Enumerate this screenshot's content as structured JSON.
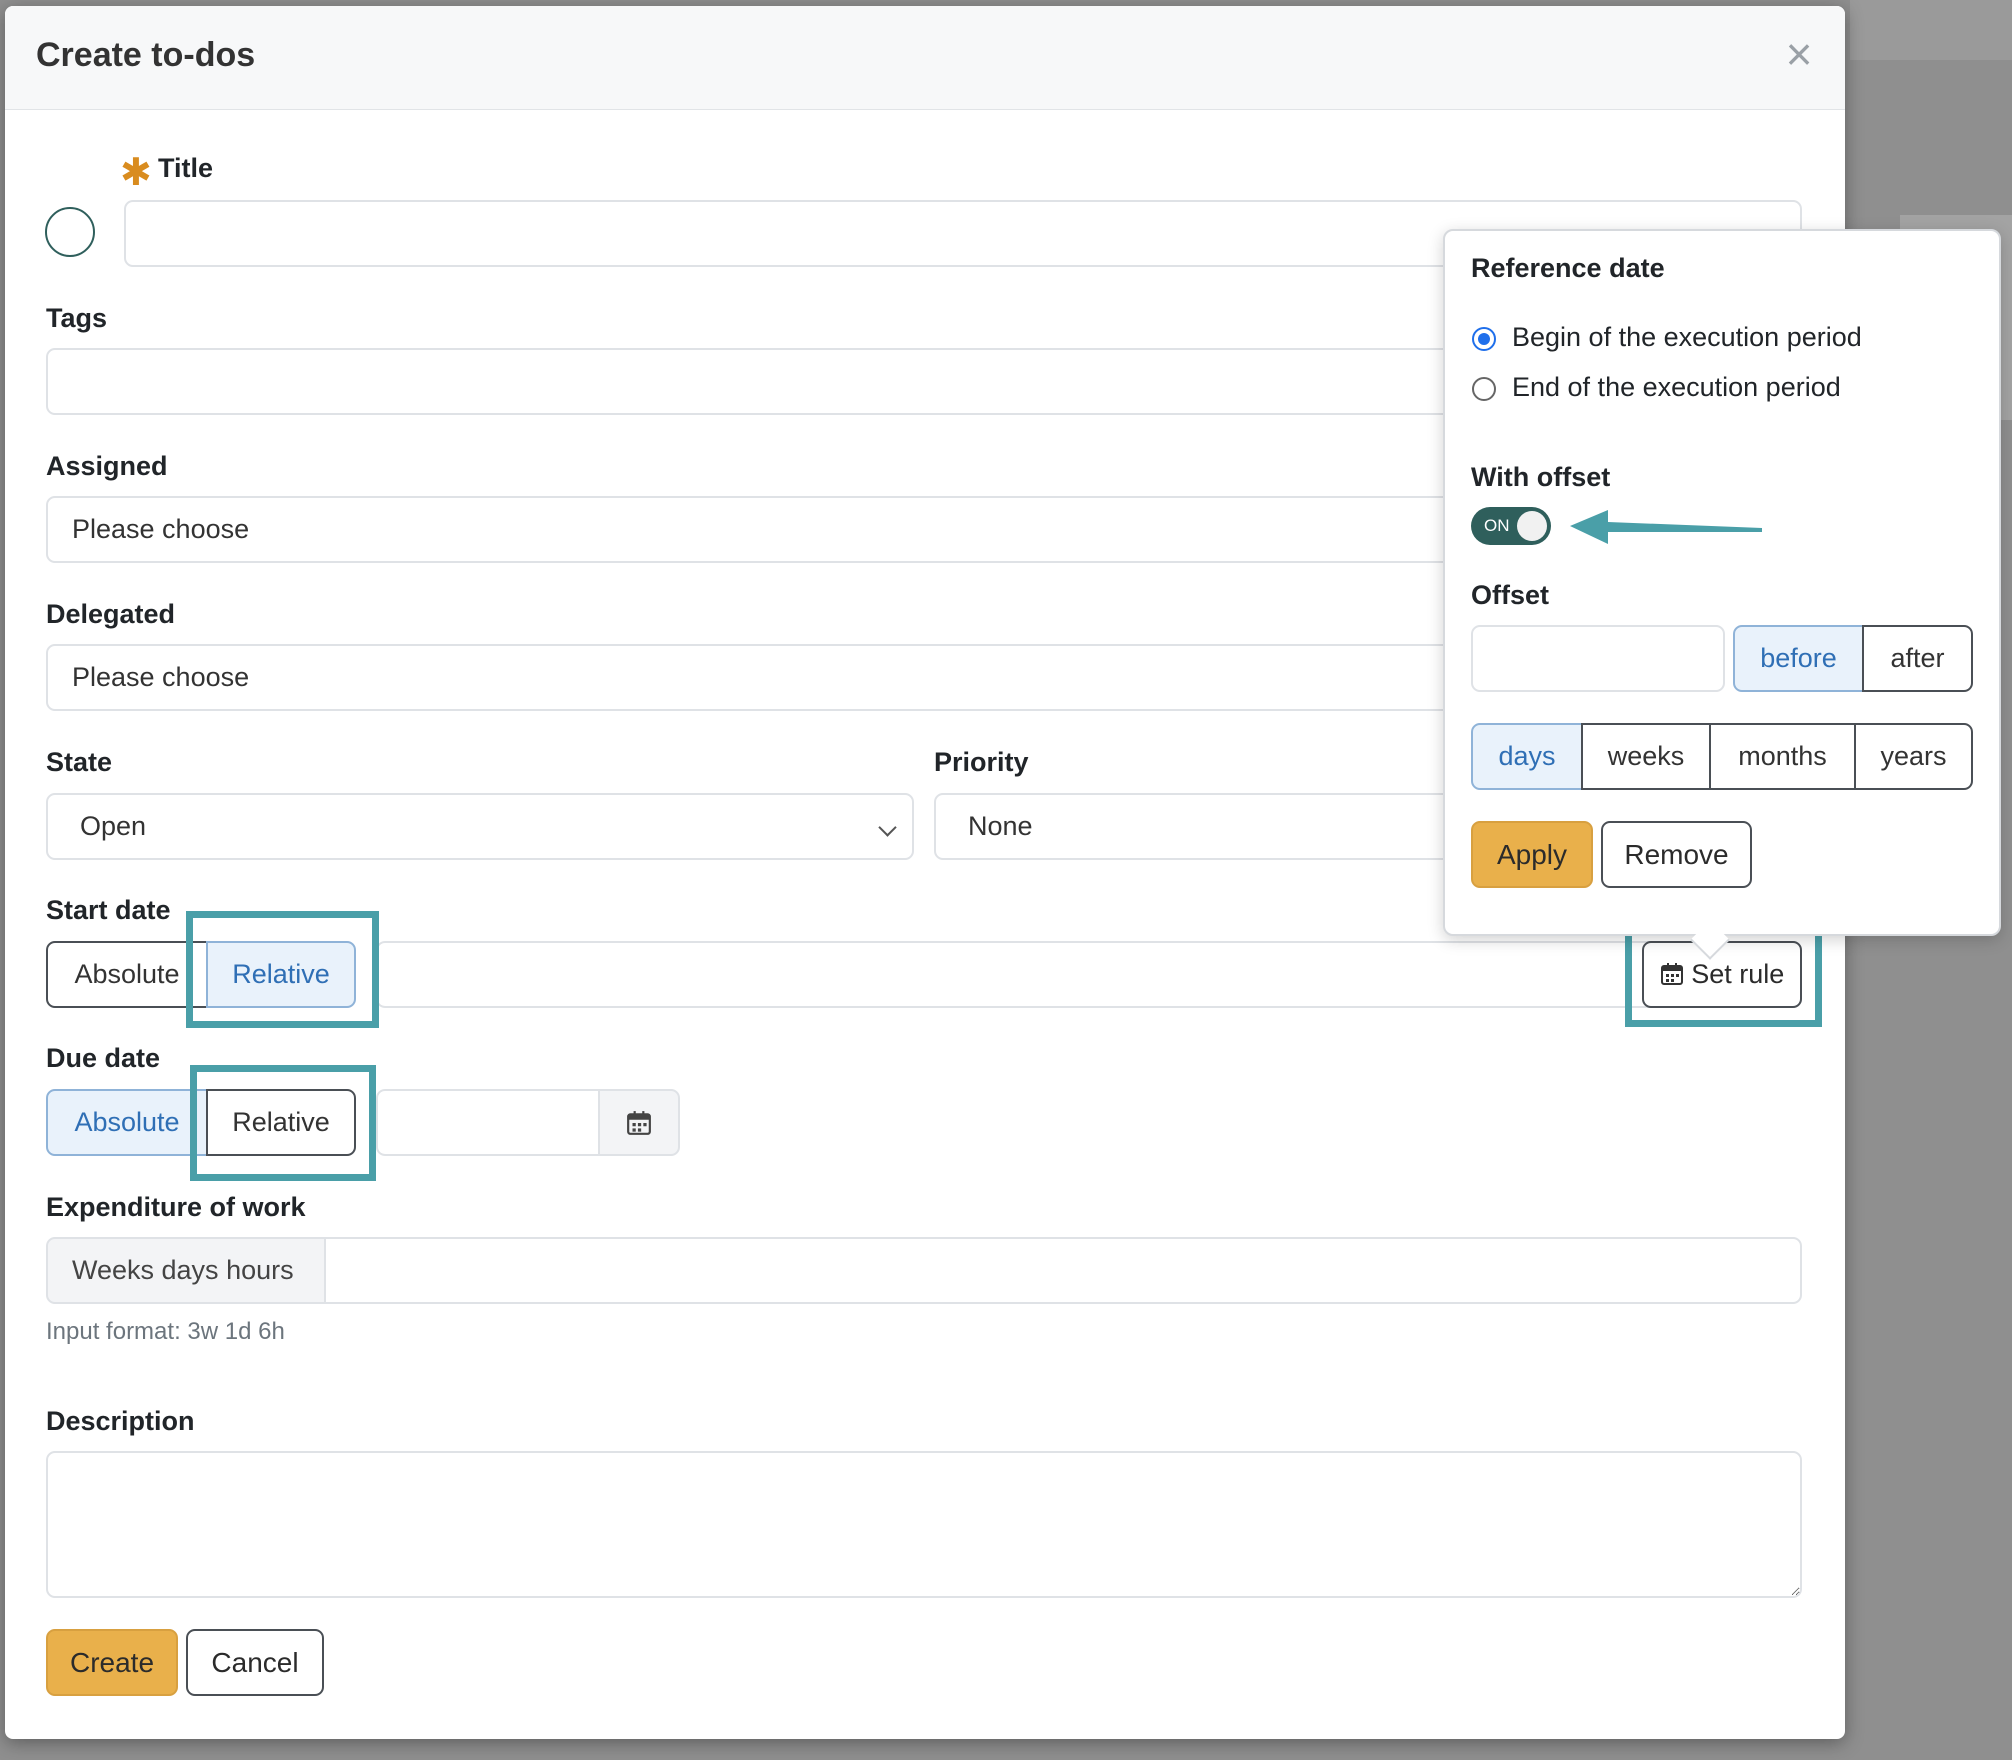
{
  "modal": {
    "title": "Create to-dos",
    "close_glyph": "×"
  },
  "form": {
    "title_label": "Title",
    "required_mark": "✱",
    "title_value": "",
    "tags_label": "Tags",
    "tags_value": "",
    "assigned_label": "Assigned",
    "assigned_value": "Please choose",
    "delegated_label": "Delegated",
    "delegated_value": "Please choose",
    "state_label": "State",
    "state_value": "Open",
    "priority_label": "Priority",
    "priority_value": "None",
    "start_date_label": "Start date",
    "due_date_label": "Due date",
    "absolute_label": "Absolute",
    "relative_label": "Relative",
    "start_mode": "Relative",
    "due_mode": "Absolute",
    "due_date_value": "",
    "set_rule_label": "Set rule",
    "expenditure_label": "Expenditure of work",
    "expenditure_addon": "Weeks days hours",
    "expenditure_value": "",
    "expenditure_hint": "Input format: 3w 1d 6h",
    "description_label": "Description",
    "description_value": "",
    "create_label": "Create",
    "cancel_label": "Cancel"
  },
  "popover": {
    "reference_label": "Reference date",
    "options": [
      {
        "label": "Begin of the execution period",
        "checked": true
      },
      {
        "label": "End of the execution period",
        "checked": false
      }
    ],
    "with_offset_label": "With offset",
    "toggle_text": "ON",
    "toggle_on": true,
    "offset_label": "Offset",
    "offset_value": "",
    "direction": [
      "before",
      "after"
    ],
    "direction_selected": "before",
    "units": [
      "days",
      "weeks",
      "months",
      "years"
    ],
    "unit_selected": "days",
    "apply_label": "Apply",
    "remove_label": "Remove"
  },
  "colors": {
    "accent_button": "#e9b04b",
    "highlight_annotation": "#4a9fa8",
    "toggle_on": "#2f5f5c",
    "active_segment_text": "#2f6fb5"
  }
}
